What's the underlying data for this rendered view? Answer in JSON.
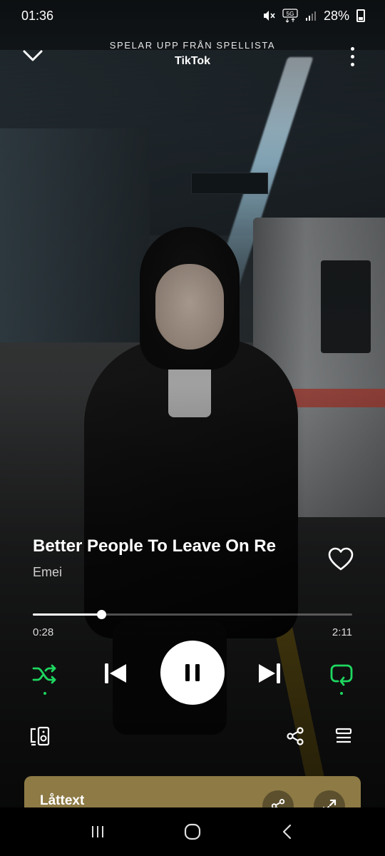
{
  "status_bar": {
    "time": "01:36",
    "network": "5G",
    "battery": "28%",
    "icons": [
      "mute-icon",
      "5g-icon",
      "signal-icon",
      "battery-icon"
    ]
  },
  "header": {
    "context_label": "SPELAR UPP FRÅN SPELLISTA",
    "context_name": "TikTok",
    "icons": [
      "chevron-down-icon",
      "more-options-icon"
    ]
  },
  "track": {
    "title": "Better People To Leave On Re",
    "artist": "Emei",
    "liked": false
  },
  "progress": {
    "elapsed": "0:28",
    "total": "2:11",
    "fraction": 0.2137
  },
  "controls": {
    "shuffle_active": true,
    "repeat_active": true,
    "playing": true,
    "accent_color": "#1ed760",
    "icons": [
      "shuffle-icon",
      "skip-previous-icon",
      "pause-icon",
      "skip-next-icon",
      "repeat-icon",
      "connect-device-icon",
      "share-icon",
      "queue-icon"
    ]
  },
  "lyrics": {
    "title": "Låttext",
    "card_color": "#8d7a45",
    "icons": [
      "share-icon",
      "expand-icon"
    ]
  },
  "navbar": {
    "icons": [
      "recents-icon",
      "home-icon",
      "back-icon"
    ]
  }
}
